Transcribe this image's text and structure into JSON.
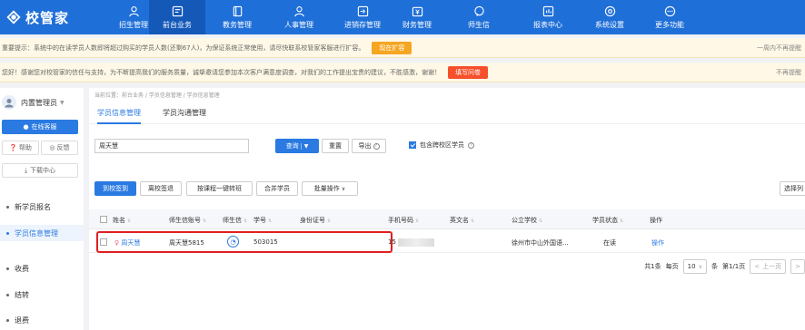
{
  "app": {
    "brand": "校管家"
  },
  "nav": [
    {
      "label": "招生管理",
      "icon": "user-icon"
    },
    {
      "label": "前台业务",
      "icon": "dashboard-icon",
      "active": true
    },
    {
      "label": "教务管理",
      "icon": "book-icon"
    },
    {
      "label": "人事管理",
      "icon": "people-icon"
    },
    {
      "label": "进销存管理",
      "icon": "inventory-icon"
    },
    {
      "label": "财务管理",
      "icon": "money-icon"
    },
    {
      "label": "师生信",
      "icon": "chat-icon"
    },
    {
      "label": "报表中心",
      "icon": "report-icon"
    },
    {
      "label": "系统设置",
      "icon": "gear-icon"
    },
    {
      "label": "更多功能",
      "icon": "more-icon"
    }
  ],
  "notices": [
    {
      "text": "重要提示：系统中的在读学员人数即将超过购买的学员人数(还剩67人)，为保证系统正常使用，请尽快联系校管家客服进行扩容。",
      "button": "现在扩容",
      "right": "一周内不再提醒"
    },
    {
      "text": "您好！感谢您对校管家的信任与支持，为不断提高我们的服务质量，诚挚邀请您参加本次客户满意度调查，对我们的工作提出宝贵的建议，不胜感激，谢谢！",
      "button": "填写问卷",
      "right": "不再提醒"
    }
  ],
  "sidebar": {
    "user": "内置管理员",
    "online": "在线客服",
    "help": "帮助",
    "feedback": "反馈",
    "download": "下载中心",
    "items": [
      {
        "label": "新学员报名"
      },
      {
        "label": "学员信息管理",
        "active": true
      },
      {
        "label": "收费"
      },
      {
        "label": "结转"
      },
      {
        "label": "退费"
      }
    ]
  },
  "main": {
    "breadcrumb": "当前位置：前台业务 / 学员信息管理 / 学员信息管理",
    "tabs": [
      "学员信息管理",
      "学员沟通管理"
    ],
    "search_value": "周天慧",
    "query_btn": "查询",
    "reset_btn": "重置",
    "export_btn": "导出",
    "include_cross": "包含跨校区学员",
    "actions": [
      "到校签到",
      "离校签退",
      "按课程一键转班",
      "合并学员",
      "批量操作"
    ],
    "choose_col": "选择列",
    "columns": [
      "姓名",
      "师生信账号",
      "师生信",
      "学号",
      "身份证号",
      "手机号码",
      "英文名",
      "公立学校",
      "学员状态",
      "操作"
    ],
    "rows": [
      {
        "name": "周天慧",
        "account": "周天慧5815",
        "student_no": "503015",
        "id_card": "",
        "phone": "15",
        "english": "",
        "school": "徐州市中山外国语...",
        "status": "在读",
        "op": "操作"
      }
    ],
    "pager": {
      "total": "共1条",
      "per_page_label": "每页",
      "per_page": "10",
      "unit": "条",
      "page_info": "第1/1页",
      "prev": "上一页"
    }
  }
}
